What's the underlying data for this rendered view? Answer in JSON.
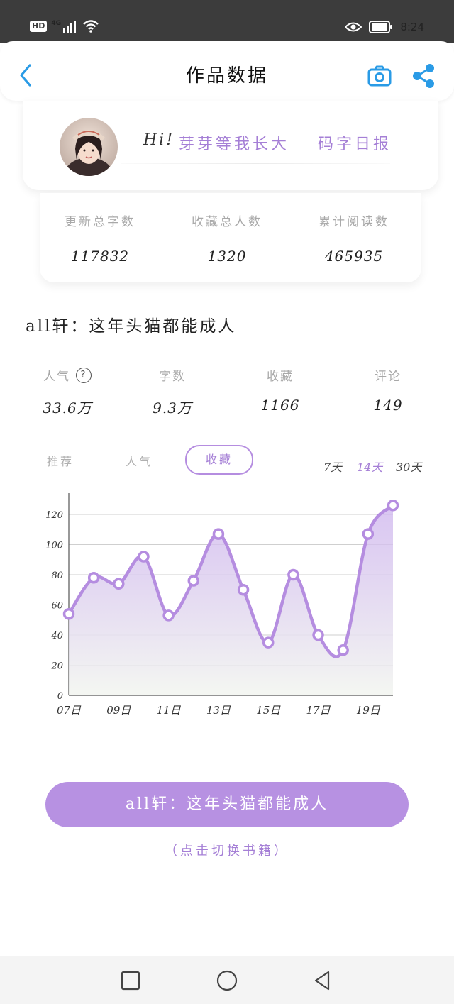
{
  "status_bar": {
    "hd": "HD",
    "network": "4G",
    "time": "8:24"
  },
  "header": {
    "title": "作品数据",
    "back_icon": "chevron-left-icon",
    "camera_icon": "camera-icon",
    "share_icon": "share-icon",
    "accent_color": "#2a9be6"
  },
  "profile": {
    "greeting": "Hi!",
    "username": "芽芽等我长大",
    "daily_report": "码字日报"
  },
  "summary": {
    "items": [
      {
        "label": "更新总字数",
        "value": "117832"
      },
      {
        "label": "收藏总人数",
        "value": "1320"
      },
      {
        "label": "累计阅读数",
        "value": "465935"
      }
    ]
  },
  "book": {
    "title": "all轩：这年头猫都能成人",
    "stats": [
      {
        "label": "人气",
        "value": "33.6万"
      },
      {
        "label": "字数",
        "value": "9.3万"
      },
      {
        "label": "收藏",
        "value": "1166"
      },
      {
        "label": "评论",
        "value": "149"
      }
    ],
    "help_icon": "help-circle-icon"
  },
  "tabs": {
    "items": [
      "推荐",
      "人气",
      "收藏"
    ],
    "active": "收藏"
  },
  "ranges": {
    "items": [
      "7天",
      "14天",
      "30天"
    ],
    "active": "14天"
  },
  "chart_data": {
    "type": "line",
    "x": [
      "07日",
      "08日",
      "09日",
      "10日",
      "11日",
      "12日",
      "13日",
      "14日",
      "15日",
      "16日",
      "17日",
      "18日",
      "19日",
      "20日"
    ],
    "tick_labels": [
      "07日",
      "09日",
      "11日",
      "13日",
      "15日",
      "17日",
      "19日"
    ],
    "values": [
      54,
      78,
      74,
      92,
      53,
      76,
      107,
      70,
      35,
      80,
      40,
      30,
      107,
      126
    ],
    "ylim": [
      0,
      120
    ],
    "yticks": [
      0,
      20,
      40,
      60,
      80,
      100,
      120
    ],
    "smooth": true,
    "grid": true,
    "line_color": "#b58de0"
  },
  "switch_button": {
    "label": "all轩：这年头猫都能成人",
    "hint": "（点击切换书籍）"
  },
  "nav": {
    "recent_icon": "square-icon",
    "home_icon": "circle-icon",
    "back_icon": "triangle-back-icon"
  }
}
